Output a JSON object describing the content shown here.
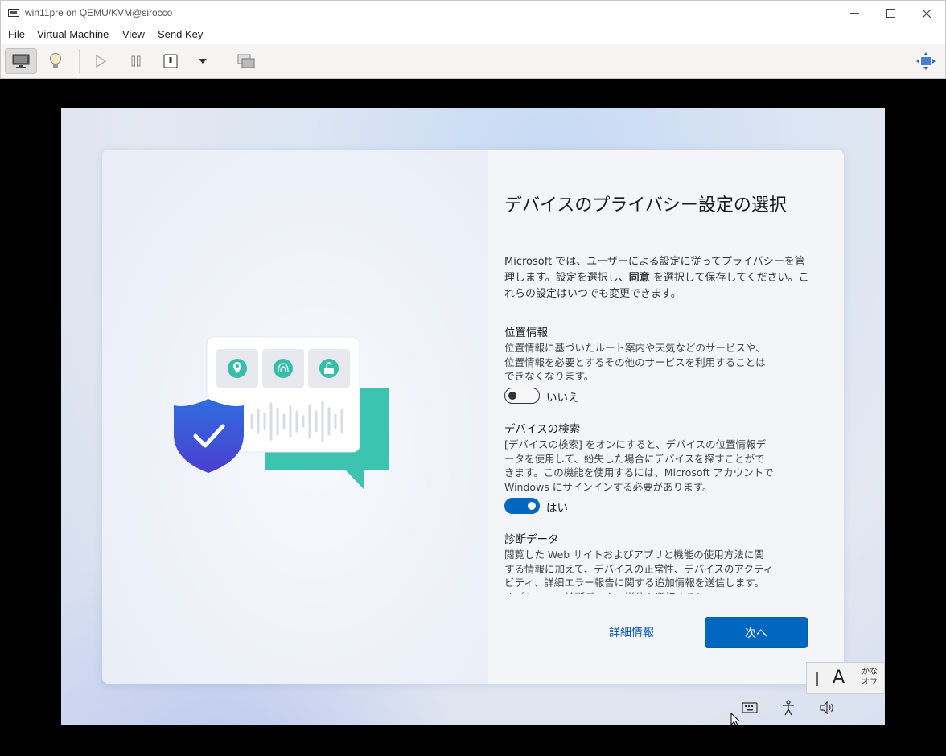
{
  "window": {
    "title": "win11pre on QEMU/KVM@sirocco",
    "controls": [
      "minimize",
      "maximize",
      "close"
    ]
  },
  "menubar": {
    "items": [
      "File",
      "Virtual Machine",
      "View",
      "Send Key"
    ]
  },
  "toolbar": {
    "buttons": [
      "console-view-icon",
      "details-lightbulb-icon",
      "run-icon",
      "pause-icon",
      "shutdown-icon",
      "shutdown-menu-chevron-icon",
      "snapshots-icon",
      "resize-fullscreen-icon"
    ]
  },
  "oobe": {
    "heading": "デバイスのプライバシー設定の選択",
    "intro_part1": "Microsoft では、ユーザーによる設定に従ってプライバシーを管理します。設定を選択し、",
    "intro_bold": "同意",
    "intro_part2": " を選択して保存してください。これらの設定はいつでも変更できます。",
    "settings": [
      {
        "title": "位置情報",
        "description": "位置情報に基づいたルート案内や天気などのサービスや、位置情報を必要とするその他のサービスを利用することはできなくなります。",
        "toggle_on": false,
        "toggle_label": "いいえ"
      },
      {
        "title": "デバイスの検索",
        "description": "[デバイスの検索] をオンにすると、デバイスの位置情報データを使用して、紛失した場合にデバイスを探すことができます。この機能を使用するには、Microsoft アカウントで Windows にサインインする必要があります。",
        "toggle_on": true,
        "toggle_label": "はい"
      },
      {
        "title": "診断データ",
        "description": "閲覧した Web サイトおよびアプリと機能の使用方法に関する情報に加えて、デバイスの正常性、デバイスのアクティビティ、詳細エラー報告に関する追加情報を送信します。オプションの診断データの送信を選択すると..."
      }
    ],
    "learn_more": "詳細情報",
    "next": "次へ"
  },
  "ime": {
    "mode_char": "A",
    "kana_line1": "かな",
    "kana_line2": "オフ"
  },
  "tray": [
    "keyboard-icon",
    "accessibility-icon",
    "volume-icon"
  ],
  "colors": {
    "accent": "#0067c0",
    "shield": "#3b5bd9",
    "chat_bubble": "#3cc4b0"
  }
}
